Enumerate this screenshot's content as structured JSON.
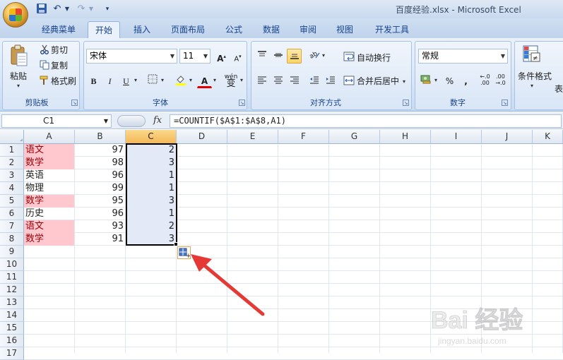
{
  "window": {
    "title": "百度经验.xlsx - Microsoft Excel"
  },
  "qat": {
    "save_icon": "save-icon",
    "undo_icon": "undo-icon",
    "redo_icon": "redo-icon"
  },
  "tabs": [
    {
      "label": "经典菜单"
    },
    {
      "label": "开始",
      "active": true
    },
    {
      "label": "插入"
    },
    {
      "label": "页面布局"
    },
    {
      "label": "公式"
    },
    {
      "label": "数据"
    },
    {
      "label": "审阅"
    },
    {
      "label": "视图"
    },
    {
      "label": "开发工具"
    }
  ],
  "ribbon": {
    "clipboard": {
      "label": "剪贴板",
      "paste": "粘贴",
      "cut": "剪切",
      "copy": "复制",
      "format_painter": "格式刷"
    },
    "font": {
      "label": "字体",
      "font_name": "宋体",
      "font_size": "11",
      "bold": "B",
      "italic": "I",
      "underline": "U",
      "grow": "A",
      "shrink": "A",
      "font_color": "A",
      "phonetic": "wén"
    },
    "alignment": {
      "label": "对齐方式",
      "wrap": "自动换行",
      "merge": "合并后居中"
    },
    "number": {
      "label": "数字",
      "format": "常规",
      "percent": "%",
      "comma": ",",
      "inc_decimal": ".00",
      "dec_decimal": ".00"
    },
    "styles": {
      "conditional": "条件格式",
      "table": "表"
    }
  },
  "formula_bar": {
    "name_box": "C1",
    "fx": "fx",
    "formula": "=COUNTIF($A$1:$A$8,A1)"
  },
  "columns": [
    "A",
    "B",
    "C",
    "D",
    "E",
    "F",
    "G",
    "H",
    "I",
    "J",
    "K"
  ],
  "selected_column": "C",
  "rows": [
    "1",
    "2",
    "3",
    "4",
    "5",
    "6",
    "7",
    "8",
    "9",
    "10",
    "11",
    "12",
    "13",
    "14",
    "15",
    "16",
    "17"
  ],
  "data_rows": [
    {
      "a": "语文",
      "b": "97",
      "c": "2",
      "highlight": true
    },
    {
      "a": "数学",
      "b": "98",
      "c": "3",
      "highlight": true
    },
    {
      "a": "英语",
      "b": "96",
      "c": "1",
      "highlight": false
    },
    {
      "a": "物理",
      "b": "99",
      "c": "1",
      "highlight": false
    },
    {
      "a": "数学",
      "b": "95",
      "c": "3",
      "highlight": true
    },
    {
      "a": "历史",
      "b": "96",
      "c": "1",
      "highlight": false
    },
    {
      "a": "语文",
      "b": "93",
      "c": "2",
      "highlight": true
    },
    {
      "a": "数学",
      "b": "91",
      "c": "3",
      "highlight": true
    }
  ],
  "colors": {
    "highlight_fill": "#ffc7ce",
    "highlight_text": "#9c0006",
    "selection_fill": "#e3e9f7",
    "arrow": "#e53935"
  },
  "watermark": {
    "text": "Bai 经验",
    "url_text": "jingyan.baidu.com"
  }
}
